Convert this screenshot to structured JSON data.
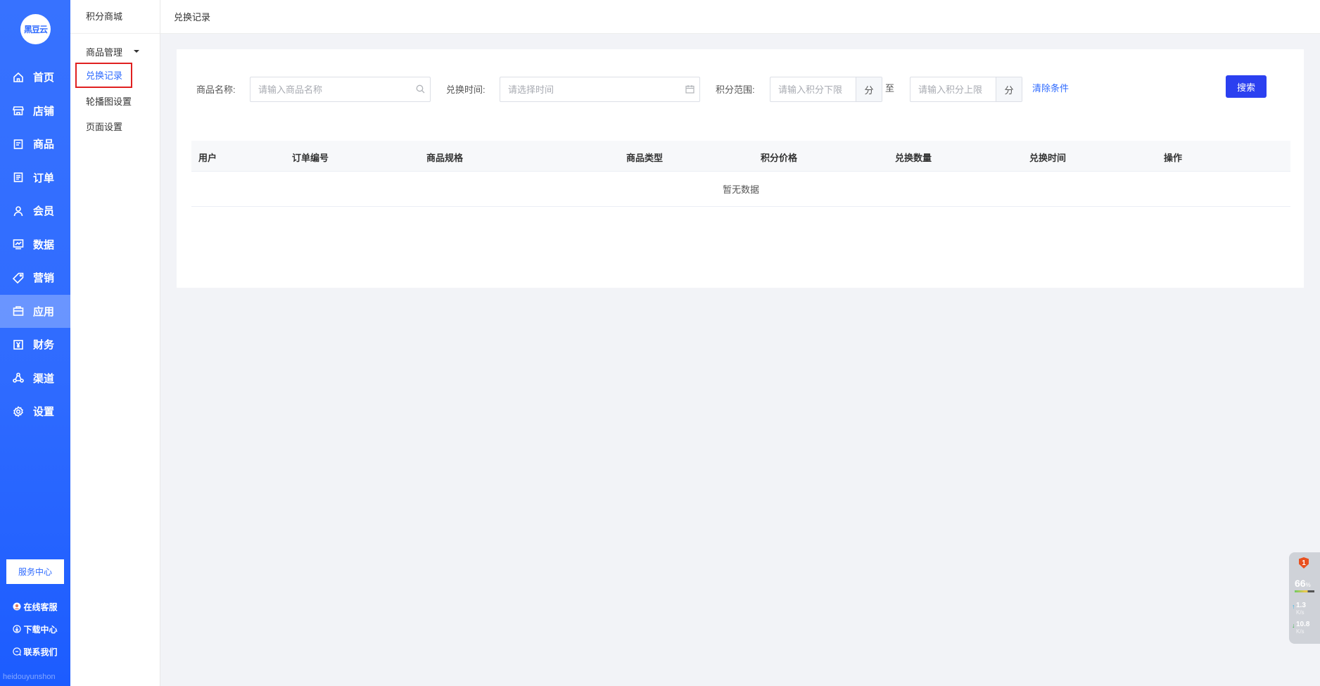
{
  "sidebar": {
    "logo_text": "黑豆云",
    "items": [
      {
        "label": "首页",
        "icon": "home-icon"
      },
      {
        "label": "店铺",
        "icon": "store-icon"
      },
      {
        "label": "商品",
        "icon": "goods-icon"
      },
      {
        "label": "订单",
        "icon": "order-icon"
      },
      {
        "label": "会员",
        "icon": "member-icon"
      },
      {
        "label": "数据",
        "icon": "chart-icon"
      },
      {
        "label": "营销",
        "icon": "tag-icon"
      },
      {
        "label": "应用",
        "icon": "app-icon",
        "active": true
      },
      {
        "label": "财务",
        "icon": "yen-icon"
      },
      {
        "label": "渠道",
        "icon": "channel-icon"
      },
      {
        "label": "设置",
        "icon": "gear-icon"
      }
    ],
    "service_center": "服务中心",
    "links": [
      {
        "label": "在线客服",
        "icon": "avatar-icon"
      },
      {
        "label": "下载中心",
        "icon": "download-icon"
      },
      {
        "label": "联系我们",
        "icon": "chat-icon"
      }
    ],
    "watermark": "heidouyunshon"
  },
  "submenu": {
    "title": "积分商城",
    "group": "商品管理",
    "items": [
      {
        "label": "兑换记录",
        "active": true
      },
      {
        "label": "轮播图设置"
      },
      {
        "label": "页面设置"
      }
    ]
  },
  "header": {
    "title": "兑换记录"
  },
  "filters": {
    "name_label": "商品名称:",
    "name_placeholder": "请输入商品名称",
    "time_label": "兑换时间:",
    "time_placeholder": "请选择时间",
    "points_label": "积分范围:",
    "min_placeholder": "请输入积分下限",
    "max_placeholder": "请输入积分上限",
    "unit": "分",
    "to": "至",
    "clear": "清除条件",
    "search": "搜索"
  },
  "table": {
    "columns": [
      "用户",
      "订单编号",
      "商品规格",
      "商品类型",
      "积分价格",
      "兑换数量",
      "兑换时间",
      "操作"
    ],
    "empty_text": "暂无数据"
  },
  "widget": {
    "badge": "1",
    "percent": "66",
    "percent_unit": "%",
    "up_rate": "1.3",
    "down_rate": "10.8",
    "rate_unit": "K/s"
  },
  "colors": {
    "primary": "#2f6bff",
    "button": "#2b40f0",
    "highlight_box": "#e02020"
  }
}
